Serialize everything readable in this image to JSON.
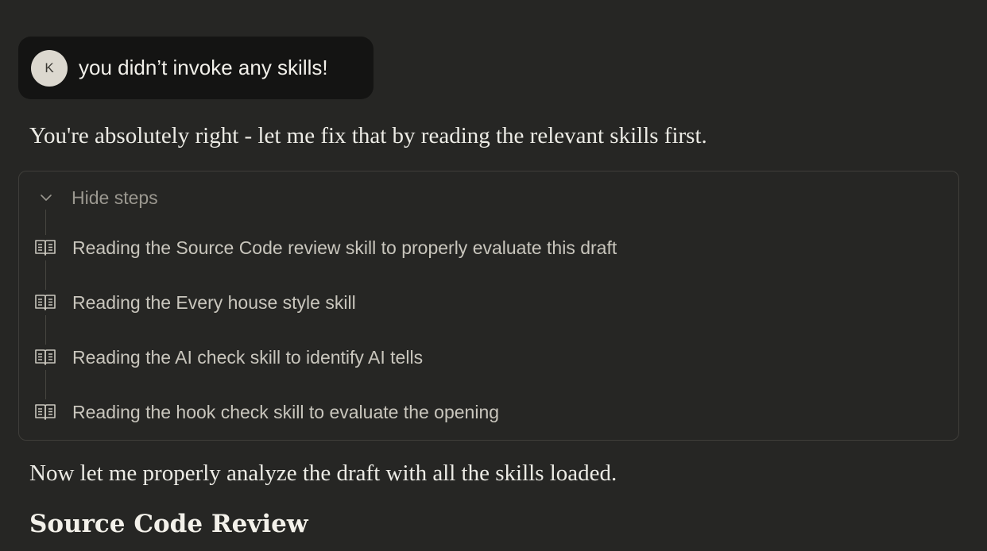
{
  "user_message": {
    "avatar_initial": "K",
    "text": "you didn’t invoke any skills!"
  },
  "assistant": {
    "intro": "You're absolutely right - let me fix that by reading the relevant skills first.",
    "steps_toggle_label": "Hide steps",
    "steps": [
      {
        "icon": "book-icon",
        "label": "Reading the Source Code review skill to properly evaluate this draft"
      },
      {
        "icon": "book-icon",
        "label": "Reading the Every house style skill"
      },
      {
        "icon": "book-icon",
        "label": "Reading the AI check skill to identify AI tells"
      },
      {
        "icon": "book-icon",
        "label": "Reading the hook check skill to evaluate the opening"
      }
    ],
    "after_steps": "Now let me properly analyze the draft with all the skills loaded.",
    "section_heading": "Source Code Review"
  }
}
